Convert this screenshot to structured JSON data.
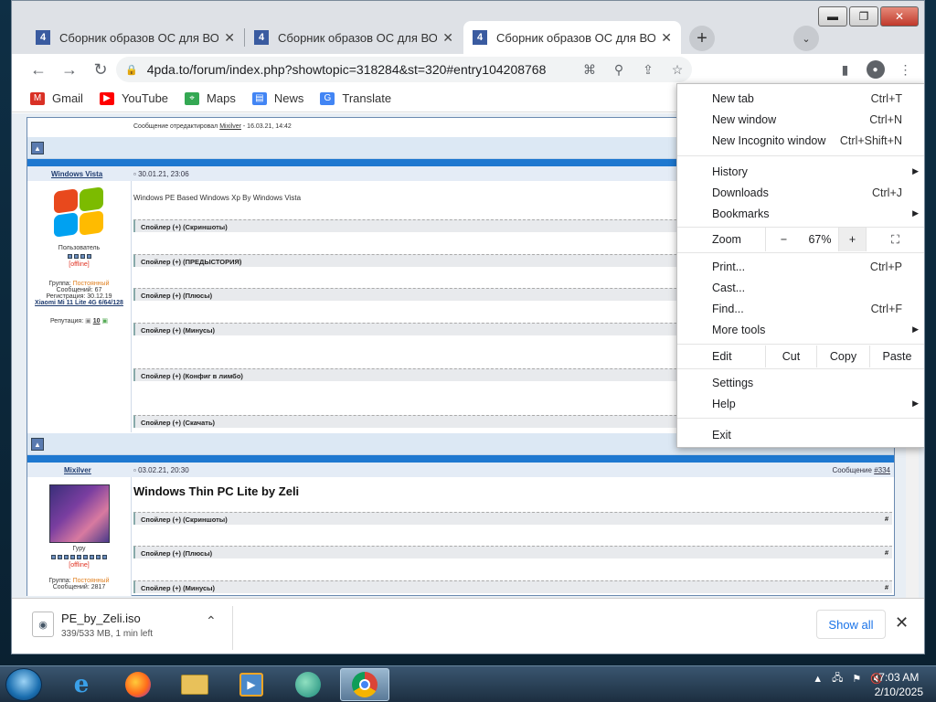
{
  "tabs": [
    {
      "title": "Сборник образов ОС для ВОСН",
      "close": "✕"
    },
    {
      "title": "Сборник образов ОС для ВОСН",
      "close": "✕"
    },
    {
      "title": "Сборник образов ОС для ВОСН",
      "close": "✕"
    }
  ],
  "new_tab": "+",
  "tab_search": "⌄",
  "window_controls": {
    "minimize": "▬",
    "maximize": "❐",
    "close": "✕"
  },
  "toolbar": {
    "back": "←",
    "forward": "→",
    "reload": "↻",
    "url": "4pda.to/forum/index.php?showtopic=318284&st=320#entry104208768"
  },
  "bookmarks": [
    "Gmail",
    "YouTube",
    "Maps",
    "News",
    "Translate"
  ],
  "forum": {
    "edited_note": "Сообщение отредактировал",
    "edited_by": "Mixilver",
    "edited_date": " - 16.03.21, 14:42",
    "post1": {
      "user": "Windows Vista",
      "date": "30.01.21, 23:06",
      "role": "Пользователь",
      "status": "[offline]",
      "group_label": "Группа: ",
      "group": "Постоянный",
      "messages": "Сообщений: 67",
      "registered": "Регистрация: 30.12.19",
      "device": "Xiaomi Mi 11 Lite 4G 6/64/128",
      "rep_label": "Репутация: ",
      "rep": "10",
      "title": "Windows PE Based Windows Xp By Windows Vista",
      "spoilers": [
        "Спойлер (+) (Скриншоты)",
        "Спойлер (+) (ПРЕДЫСТОРИЯ)",
        "Спойлер (+) (Плюсы)",
        "Спойлер (+) (Минусы)",
        "Спойлер (+) (Конфиг в лимбо)",
        "Спойлер (+) (Скачать)"
      ]
    },
    "post2": {
      "user": "Mixilver",
      "date": "03.02.21, 20:30",
      "msg_label": "Сообщение ",
      "msg_num": "#334",
      "role": "Гуру",
      "status": "[offline]",
      "group_label": "Группа: ",
      "group": "Постоянный",
      "messages": "Сообщений: 2817",
      "title": "Windows Thin PC Lite by Zeli",
      "spoilers": [
        "Спойлер (+) (Скриншоты)",
        "Спойлер (+) (Плюсы)",
        "Спойлер (+) (Минусы)"
      ],
      "hash": "#"
    }
  },
  "menu": {
    "new_tab": "New tab",
    "new_tab_sc": "Ctrl+T",
    "new_window": "New window",
    "new_window_sc": "Ctrl+N",
    "incognito": "New Incognito window",
    "incognito_sc": "Ctrl+Shift+N",
    "history": "History",
    "downloads": "Downloads",
    "downloads_sc": "Ctrl+J",
    "bookmarks": "Bookmarks",
    "zoom": "Zoom",
    "zoom_minus": "−",
    "zoom_value": "67%",
    "zoom_plus": "+",
    "print": "Print...",
    "print_sc": "Ctrl+P",
    "cast": "Cast...",
    "find": "Find...",
    "find_sc": "Ctrl+F",
    "more_tools": "More tools",
    "edit": "Edit",
    "cut": "Cut",
    "copy": "Copy",
    "paste": "Paste",
    "settings": "Settings",
    "help": "Help",
    "exit": "Exit"
  },
  "download": {
    "filename": "PE_by_Zeli.iso",
    "status": "339/533 MB, 1 min left",
    "show_all": "Show all"
  },
  "taskbar": {
    "time": "7:03 AM",
    "date": "2/10/2025"
  },
  "colors": {
    "accent": "#1a73e8",
    "forum_blue": "#1e78d0",
    "offline": "#e03020",
    "group": "#e08020"
  }
}
